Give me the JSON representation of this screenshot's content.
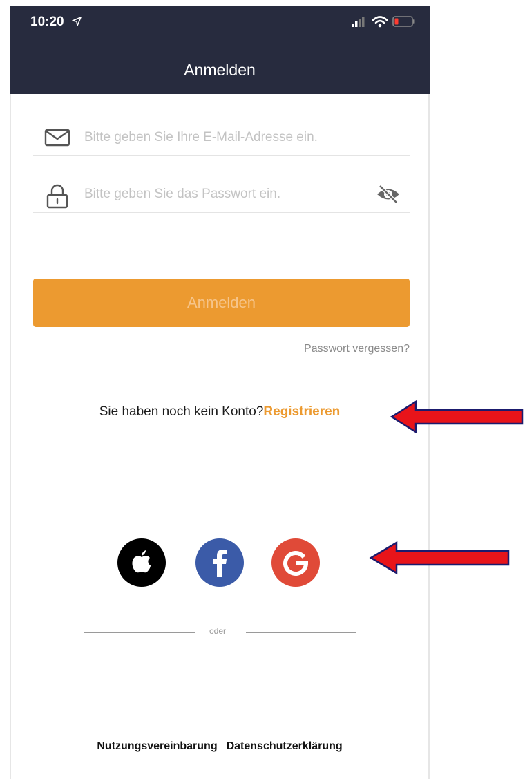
{
  "status_bar": {
    "time": "10:20",
    "icons": [
      "location-arrow-icon",
      "cellular-signal-icon",
      "wifi-icon",
      "battery-low-icon"
    ]
  },
  "header": {
    "title": "Anmelden"
  },
  "form": {
    "email": {
      "placeholder": "Bitte geben Sie Ihre E-Mail-Adresse ein.",
      "value": "",
      "icon": "mail-icon"
    },
    "password": {
      "placeholder": "Bitte geben Sie das Passwort ein.",
      "value": "",
      "icon": "lock-icon",
      "toggle_icon": "eye-slash-icon"
    },
    "login_label": "Anmelden",
    "forgot_label": "Passwort vergessen?"
  },
  "register": {
    "prompt": "Sie haben noch kein Konto?",
    "link_label": "Registrieren"
  },
  "divider": {
    "label": "oder"
  },
  "social": [
    {
      "name": "apple-icon",
      "color": "#000000"
    },
    {
      "name": "facebook-icon",
      "color": "#3b5ba8"
    },
    {
      "name": "google-icon",
      "color": "#e04a38"
    }
  ],
  "footer": {
    "terms_label": "Nutzungsvereinbarung",
    "privacy_label": "Datenschutzerklärung"
  },
  "colors": {
    "header_bg": "#272b3e",
    "accent": "#ec9a30",
    "annotation_arrow": "#e8141a"
  }
}
